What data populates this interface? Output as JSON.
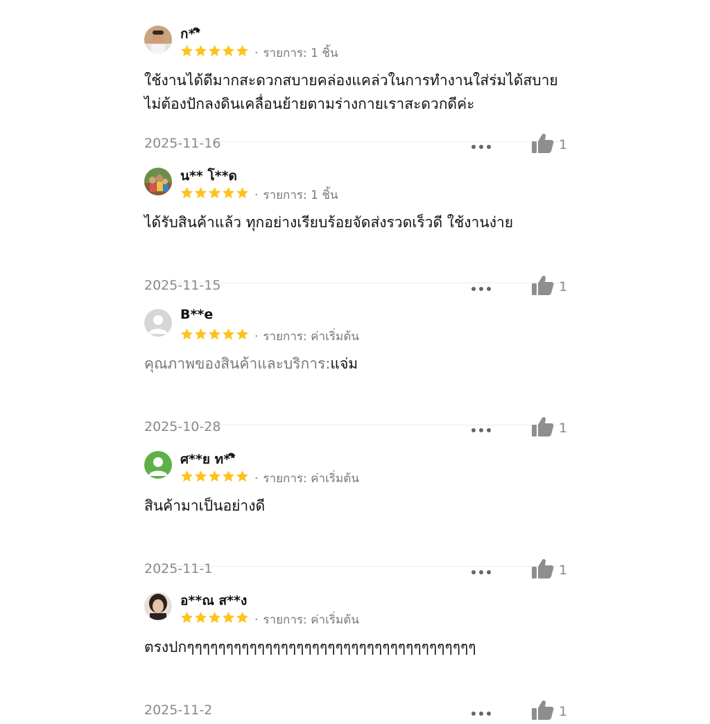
{
  "reviews": [
    {
      "username": "ก**ิ",
      "rating": 5,
      "meta_prefix": "รายการ: ",
      "meta_value": "1 ชิ้น",
      "body_prefix": "",
      "body_text": "ใช้งานได้ดีมากสะดวกสบายคล่องแคล่วในการทำงานใส่ร่มได้สบายไม่ต้องปักลงดินเคลื่อนย้ายตามร่างกายเราสะดวกดีค่ะ",
      "date": "2025-11-16",
      "likes": "1",
      "avatar": "avatar-photo-man"
    },
    {
      "username": "น** โ**ด",
      "rating": 5,
      "meta_prefix": "รายการ: ",
      "meta_value": "1 ชิ้น",
      "body_prefix": "",
      "body_text": "ได้รับสินค้าแล้ว ทุกอย่างเรียบร้อยจัดส่งรวดเร็วดี ใช้งานง่าย",
      "date": "2025-11-15",
      "likes": "1",
      "avatar": "avatar-photo-group"
    },
    {
      "username": "B**e",
      "rating": 5,
      "meta_prefix": "รายการ: ",
      "meta_value": "ค่าเริ่มต้น",
      "body_prefix": "คุณภาพของสินค้าและบริการ:",
      "body_text": "แจ่ม",
      "date": "2025-10-28",
      "likes": "1",
      "avatar": "avatar-default-gray"
    },
    {
      "username": "ศ**ย ท**ิ",
      "rating": 5,
      "meta_prefix": "รายการ: ",
      "meta_value": "ค่าเริ่มต้น",
      "body_prefix": "",
      "body_text": "สินค้ามาเป็นอย่างดี",
      "date": "2025-11-1",
      "likes": "1",
      "avatar": "avatar-default-green"
    },
    {
      "username": "อ**ณ ส**ง",
      "rating": 5,
      "meta_prefix": "รายการ: ",
      "meta_value": "ค่าเริ่มต้น",
      "body_prefix": "",
      "body_text": "ตรงปกๆๆๆๆๆๆๆๆๆๆๆๆๆๆๆๆๆๆๆๆๆๆๆๆๆๆๆๆๆๆๆๆๆๆๆๆๆ",
      "date": "2025-11-2",
      "likes": "1",
      "avatar": "avatar-photo-woman"
    }
  ],
  "colors": {
    "star": "#FFC21A",
    "like_icon": "#8e8e8e",
    "gray_text": "#777777",
    "avatar_gray": "#d6d6d6",
    "avatar_green": "#5fb04a"
  }
}
